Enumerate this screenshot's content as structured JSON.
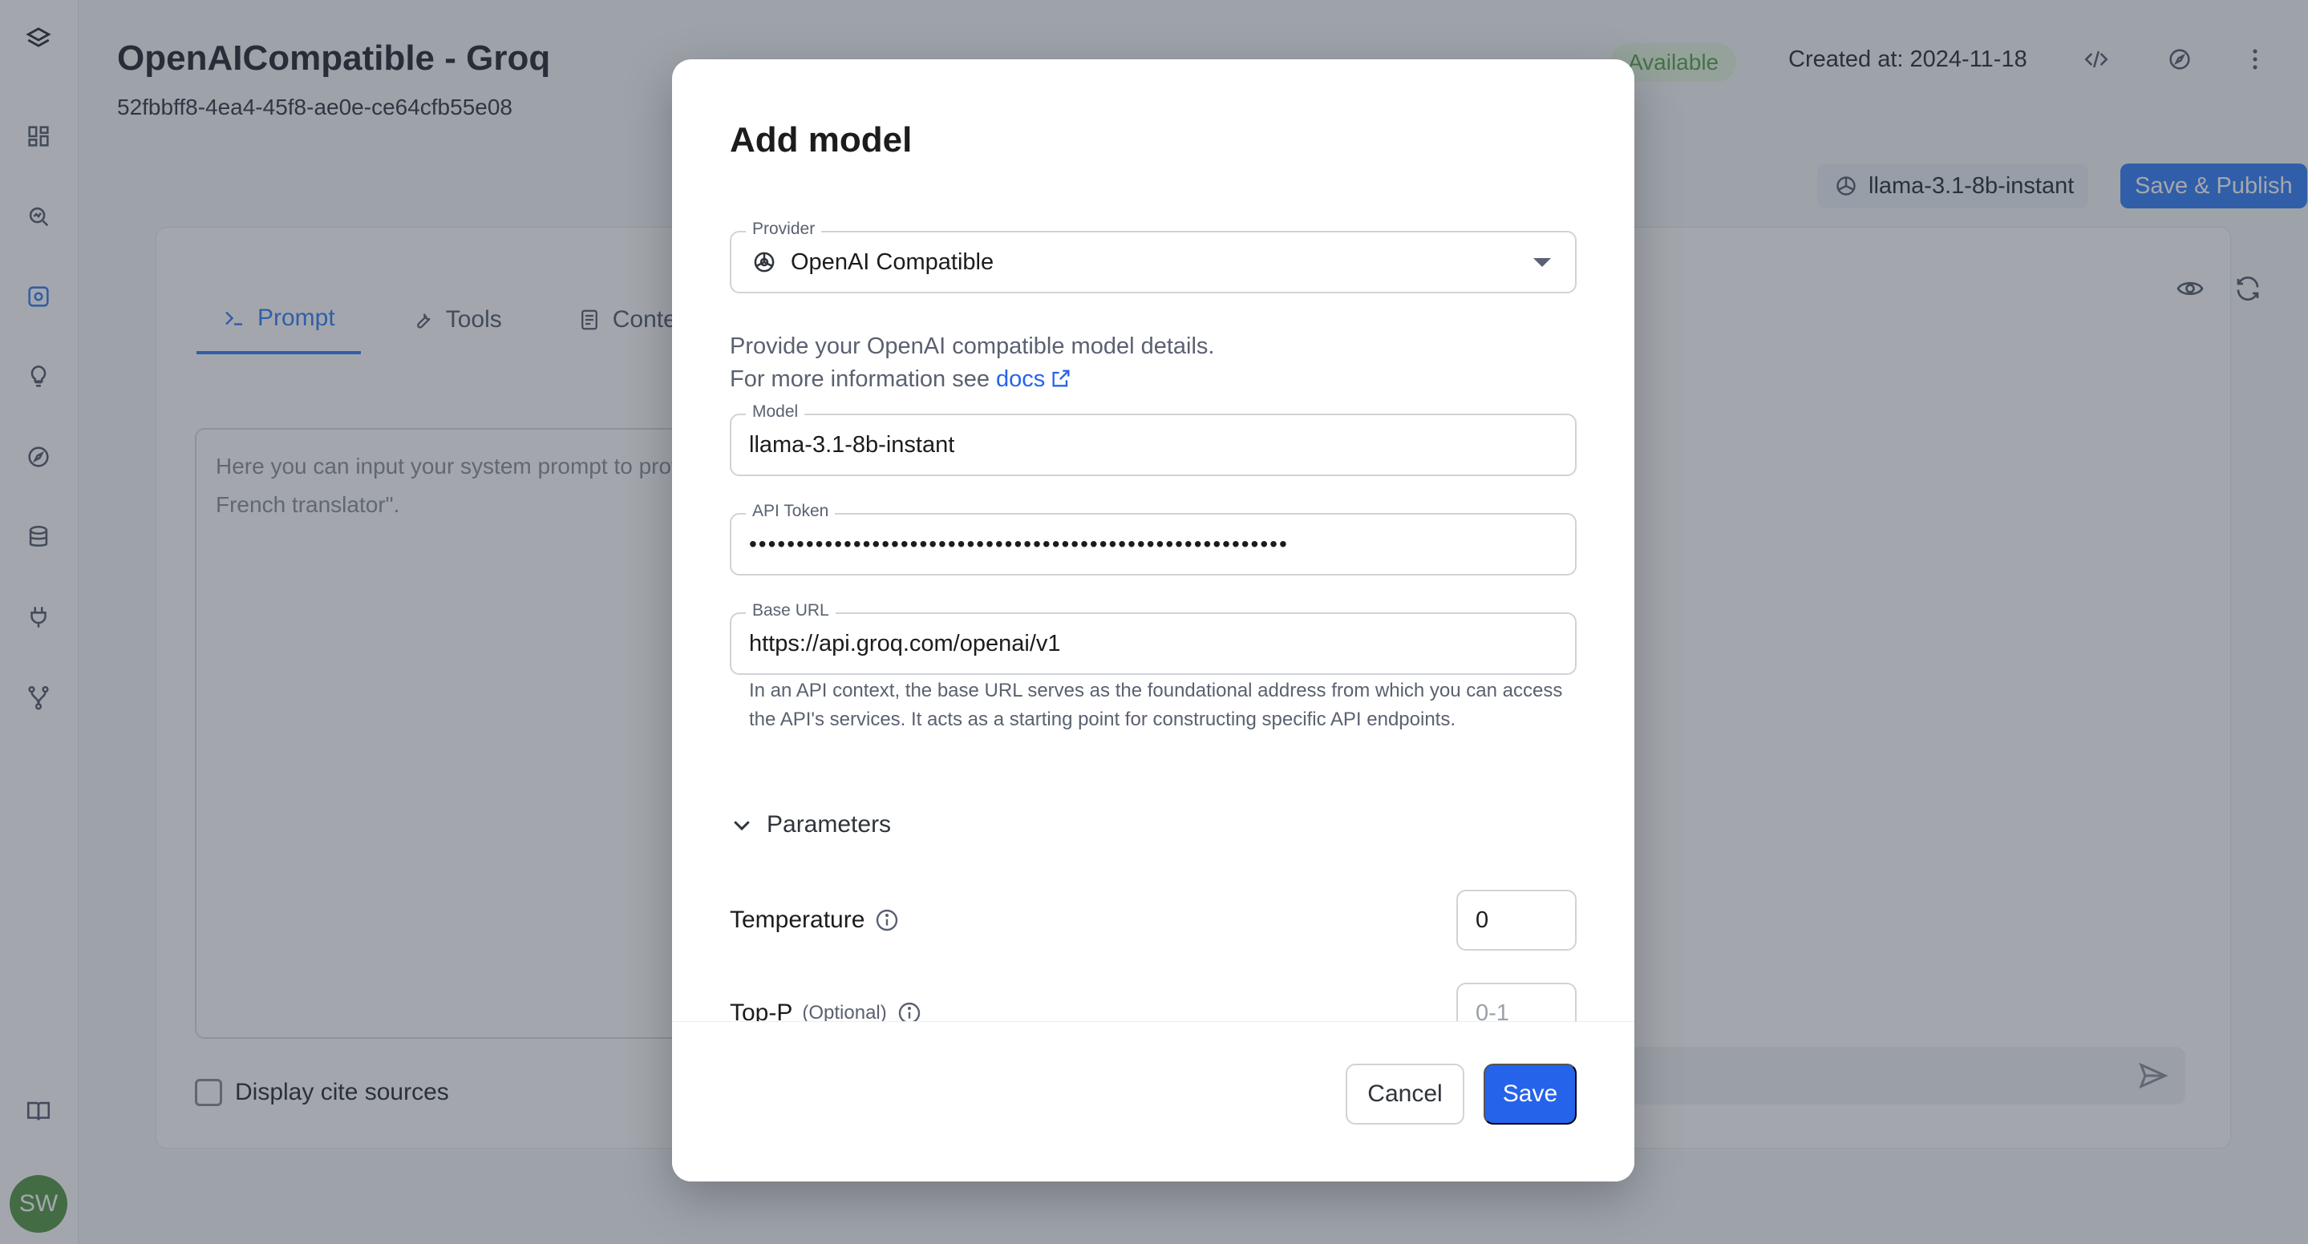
{
  "sidebar": {
    "logo_icon": "stack-logo-icon",
    "items": [
      {
        "icon": "dashboard-icon"
      },
      {
        "icon": "search-analytics-icon"
      },
      {
        "icon": "agents-icon"
      },
      {
        "icon": "lightbulb-icon"
      },
      {
        "icon": "compass-icon"
      },
      {
        "icon": "database-icon"
      },
      {
        "icon": "plug-icon"
      },
      {
        "icon": "branch-icon"
      }
    ],
    "docs_icon": "book-icon",
    "avatar_initials": "SW"
  },
  "header": {
    "title": "OpenAICompatible - Groq",
    "id": "52fbbff8-4ea4-45f8-ae0e-ce64cfb55e08",
    "status": "Available",
    "created": "Created at: 2024-11-18"
  },
  "toolbar": {
    "model_chip": "llama-3.1-8b-instant",
    "publish_label": "Save & Publish"
  },
  "panel": {
    "tabs": [
      {
        "label": "Prompt",
        "icon": "terminal-icon",
        "active": true
      },
      {
        "label": "Tools",
        "icon": "wrench-icon",
        "active": false
      },
      {
        "label": "Context",
        "icon": "document-icon",
        "active": false
      }
    ],
    "prompt_placeholder": "Here you can input your system prompt to provide to your users. For example, \"Be co an expert French translator\".",
    "cite_label": "Display cite sources"
  },
  "modal": {
    "title": "Add model",
    "provider": {
      "label": "Provider",
      "value": "OpenAI Compatible"
    },
    "description_line1": "Provide your OpenAI compatible model details.",
    "description_line2": "For more information see ",
    "docs_link": "docs",
    "model": {
      "label": "Model",
      "value": "llama-3.1-8b-instant"
    },
    "api_token": {
      "label": "API Token",
      "value": "•••••••••••••••••••••••••••••••••••••••••••••••••••••••••"
    },
    "base_url": {
      "label": "Base URL",
      "value": "https://api.groq.com/openai/v1",
      "helper": "In an API context, the base URL serves as the foundational address from which you can access the API's services. It acts as a starting point for constructing specific API endpoints."
    },
    "parameters_label": "Parameters",
    "temperature": {
      "label": "Temperature",
      "value": "0"
    },
    "top_p": {
      "label": "Top-P",
      "optional": "(Optional)",
      "placeholder": "0-1"
    },
    "cancel_label": "Cancel",
    "save_label": "Save"
  },
  "colors": {
    "accent": "#3b82f6",
    "save_button": "#2563eb",
    "status_green": "#5aa64a",
    "avatar": "#5b9a4c"
  }
}
